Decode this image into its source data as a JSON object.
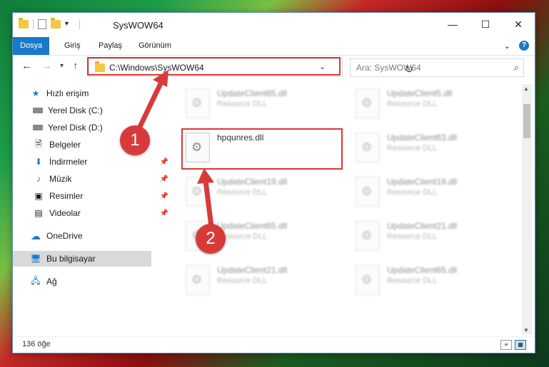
{
  "window": {
    "title": "SysWOW64"
  },
  "title_buttons": {
    "minimize": "—",
    "maximize": "☐",
    "close": "✕"
  },
  "ribbon": {
    "tabs": [
      "Dosya",
      "Giriş",
      "Paylaş",
      "Görünüm"
    ],
    "active_tab": "Dosya"
  },
  "address_bar": {
    "path": "C:\\Windows\\SysWOW64"
  },
  "search": {
    "placeholder": "Ara: SysWOW64"
  },
  "nav_pane": {
    "items": [
      {
        "label": "Hızlı erişim",
        "icon": "star-icon"
      },
      {
        "label": "Yerel Disk (C:)",
        "icon": "drive-icon"
      },
      {
        "label": "Yerel Disk (D:)",
        "icon": "drive-icon"
      },
      {
        "label": "Belgeler",
        "icon": "document-icon"
      },
      {
        "label": "İndirmeler",
        "icon": "download-icon"
      },
      {
        "label": "Müzik",
        "icon": "music-icon"
      },
      {
        "label": "Resimler",
        "icon": "pictures-icon"
      },
      {
        "label": "Videolar",
        "icon": "video-icon"
      },
      {
        "label": "OneDrive",
        "icon": "cloud-icon"
      },
      {
        "label": "Bu bilgisayar",
        "icon": "computer-icon"
      },
      {
        "label": "Ağ",
        "icon": "network-icon"
      }
    ]
  },
  "files": [
    {
      "name": "UpdateClient65.dll",
      "type": "Resource DLL",
      "blurred": true
    },
    {
      "name": "UpdateClient5.dll",
      "type": "Resource DLL",
      "blurred": true
    },
    {
      "name": "hpqunres.dll",
      "type": "",
      "blurred": false
    },
    {
      "name": "UpdateClient63.dll",
      "type": "Resource DLL",
      "blurred": true
    },
    {
      "name": "UpdateClient19.dll",
      "type": "Resource DLL",
      "blurred": true
    },
    {
      "name": "UpdateClient19.dll",
      "type": "Resource DLL",
      "blurred": true
    },
    {
      "name": "UpdateClient65.dll",
      "type": "Resource DLL",
      "blurred": true
    },
    {
      "name": "UpdateClient21.dll",
      "type": "Resource DLL",
      "blurred": true
    },
    {
      "name": "UpdateClient21.dll",
      "type": "Resource DLL",
      "blurred": true
    },
    {
      "name": "UpdateClient65.dll",
      "type": "Resource DLL",
      "blurred": true
    }
  ],
  "status": {
    "count": "136 öğe"
  },
  "callouts": {
    "one": "1",
    "two": "2"
  },
  "colors": {
    "accent": "#1979ca",
    "callout": "#d83a3a"
  }
}
